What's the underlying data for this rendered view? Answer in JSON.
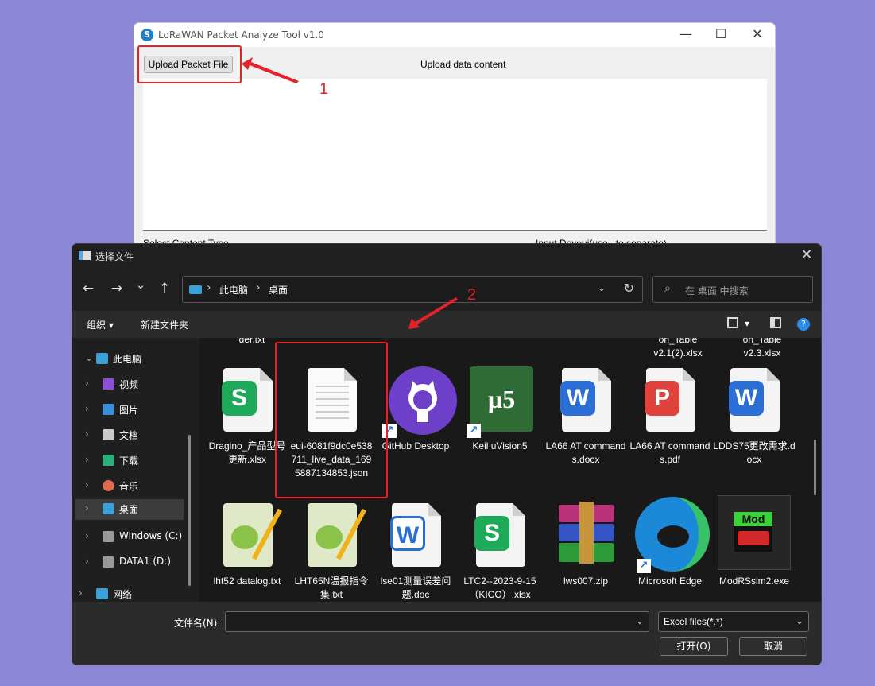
{
  "app": {
    "title": "LoRaWAN Packet Analyze Tool v1.0",
    "upload_button": "Upload Packet File",
    "content_label": "Upload data content",
    "select_content_type_label": "Select Content Type",
    "input_deveui_label": "Input Deveui(use , to separate)",
    "logo_glyph": "S",
    "minimize_glyph": "—",
    "maximize_glyph": "☐",
    "close_glyph": "✕"
  },
  "annotations": {
    "step1": "1",
    "step2": "2",
    "color": "#e3222a"
  },
  "dialog": {
    "title": "选择文件",
    "close_glyph": "✕",
    "nav": {
      "back": "←",
      "forward": "→",
      "recent": "⌄",
      "up": "↑"
    },
    "breadcrumb": [
      "此电脑",
      "桌面"
    ],
    "breadcrumb_sep": "›",
    "address_dropdown": "⌄",
    "refresh_glyph": "↻",
    "search_icon": "⌕",
    "search_placeholder": "在 桌面 中搜索",
    "toolbar": {
      "organize": "组织 ▾",
      "new_folder": "新建文件夹",
      "view_dropdown": "▾",
      "help": "?"
    },
    "sidebar": [
      {
        "label": "此电脑",
        "expanded": true,
        "icon": "pc-icon",
        "color": "#3aa0d8"
      },
      {
        "label": "视频",
        "icon": "video-icon",
        "color": "#8d4fd6"
      },
      {
        "label": "图片",
        "icon": "pictures-icon",
        "color": "#3b8fd8"
      },
      {
        "label": "文档",
        "icon": "documents-icon",
        "color": "#c9c9c9"
      },
      {
        "label": "下载",
        "icon": "downloads-icon",
        "color": "#2ab07a"
      },
      {
        "label": "音乐",
        "icon": "music-icon",
        "color": "#e06a4f"
      },
      {
        "label": "桌面",
        "icon": "desktop-icon",
        "color": "#3aa0d8",
        "selected": true
      },
      {
        "label": "Windows (C:)",
        "icon": "drive-icon",
        "color": "#9a9a9a"
      },
      {
        "label": "DATA1 (D:)",
        "icon": "drive-icon",
        "color": "#9a9a9a"
      },
      {
        "label": "网络",
        "icon": "network-icon",
        "color": "#3aa0d8"
      }
    ],
    "sidebar_arrows": {
      "expanded": "⌄",
      "collapsed": "›"
    },
    "partial_top_labels": [
      "der.txt",
      "on_Table\nv2.1(2).xlsx",
      "on_Table\nv2.3.xlsx"
    ],
    "files_row1": [
      {
        "name": "Dragino_产品型号更新.xlsx",
        "icon": "wps-spreadsheet-icon",
        "glyph": "S",
        "color": "#1faa5a"
      },
      {
        "name": "eui-6081f9dc0e538711_live_data_1695887134853.json",
        "icon": "text-file-icon"
      },
      {
        "name": "GitHub Desktop",
        "icon": "github-icon",
        "color": "#6e40c9",
        "shortcut": true
      },
      {
        "name": "Keil uVision5",
        "icon": "keil-icon",
        "glyph": "µ5",
        "color": "#2f6b35",
        "shortcut": true
      },
      {
        "name": "LA66 AT commands.docx",
        "icon": "wps-writer-icon",
        "glyph": "W",
        "color": "#2b6fd6"
      },
      {
        "name": "LA66 AT commands.pdf",
        "icon": "wps-pdf-icon",
        "glyph": "P",
        "color": "#e0433c"
      },
      {
        "name": "LDDS75更改需求.docx",
        "icon": "wps-writer-icon",
        "glyph": "W",
        "color": "#2b6fd6"
      }
    ],
    "files_row2": [
      {
        "name": "lht52 datalog.txt",
        "icon": "notepad-plus-plus-icon"
      },
      {
        "name": "LHT65N温报指令集.txt",
        "icon": "notepad-plus-plus-icon"
      },
      {
        "name": "lse01测量误差问题.doc",
        "icon": "wps-writer-icon",
        "glyph": "W",
        "color": "#2b6fd6"
      },
      {
        "name": "LTC2--2023-9-15（KICO）.xlsx",
        "icon": "wps-spreadsheet-icon",
        "glyph": "S",
        "color": "#1faa5a"
      },
      {
        "name": "lws007.zip",
        "icon": "winrar-archive-icon"
      },
      {
        "name": "Microsoft Edge",
        "icon": "edge-icon",
        "shortcut": true
      },
      {
        "name": "ModRSsim2.exe",
        "icon": "modrssim-icon",
        "glyph": "Mod"
      }
    ],
    "shortcut_glyph": "↗",
    "filename_label": "文件名(N):",
    "filename_value": "",
    "filename_dropdown": "⌄",
    "filetype": "Excel files(*.*)",
    "filetype_dropdown": "⌄",
    "open_button": "打开(O)",
    "cancel_button": "取消"
  }
}
